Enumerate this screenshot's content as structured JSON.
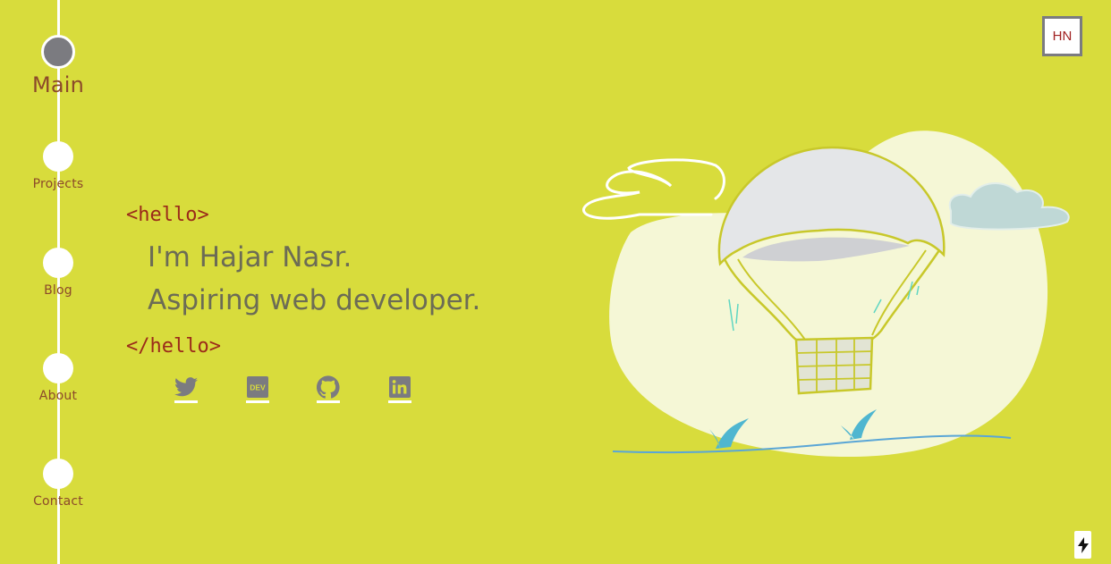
{
  "nav": {
    "items": [
      {
        "label": "Main",
        "active": true
      },
      {
        "label": "Projects",
        "active": false
      },
      {
        "label": "Blog",
        "active": false
      },
      {
        "label": "About",
        "active": false
      },
      {
        "label": "Contact",
        "active": false
      }
    ]
  },
  "logo": {
    "text": "HN"
  },
  "hero": {
    "open_tag": "<hello>",
    "line1": "I'm Hajar Nasr.",
    "line2": "Aspiring web developer.",
    "close_tag": "</hello>"
  },
  "social": [
    {
      "name": "twitter",
      "icon": "twitter-icon"
    },
    {
      "name": "dev",
      "icon": "dev-icon",
      "text": "DEV"
    },
    {
      "name": "github",
      "icon": "github-icon"
    },
    {
      "name": "linkedin",
      "icon": "linkedin-icon"
    }
  ],
  "colors": {
    "background": "#d8dc3c",
    "accent": "#8c4a2a",
    "tag": "#9b2a1a",
    "text": "#6c6c55",
    "icon": "#7b7b80"
  },
  "footer": {
    "text": "·· · ·· · ··"
  }
}
